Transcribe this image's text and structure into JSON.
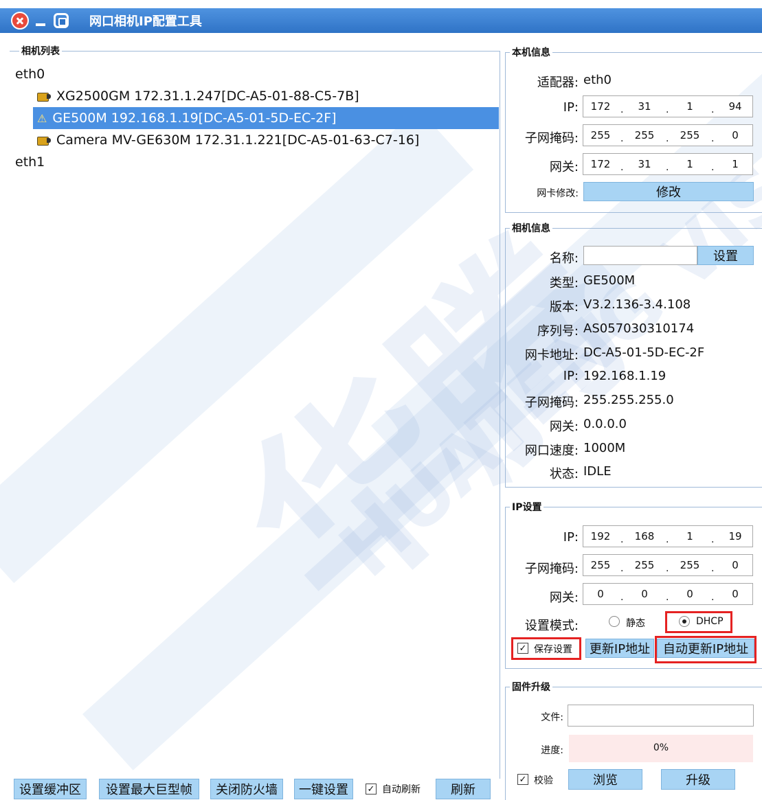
{
  "window": {
    "title": "网口相机IP配置工具"
  },
  "watermark": {
    "brand_cn": "华腾",
    "brand_en": "HUATENG VISION"
  },
  "camera_list": {
    "title": "相机列表",
    "adapters": [
      {
        "name": "eth0",
        "cameras": [
          {
            "label": "XG2500GM 172.31.1.247[DC-A5-01-88-C5-7B]",
            "icon": "camera-icon",
            "selected": false
          },
          {
            "label": "GE500M 192.168.1.19[DC-A5-01-5D-EC-2F]",
            "icon": "warning-icon",
            "selected": true
          },
          {
            "label": "Camera MV-GE630M 172.31.1.221[DC-A5-01-63-C7-16]",
            "icon": "camera-icon",
            "selected": false
          }
        ]
      },
      {
        "name": "eth1",
        "cameras": []
      }
    ]
  },
  "bottom": {
    "set_buffer": "设置缓冲区",
    "set_jumbo": "设置最大巨型帧",
    "close_firewall": "关闭防火墙",
    "one_key": "一键设置",
    "auto_refresh": "自动刷新",
    "auto_refresh_checked": true,
    "refresh": "刷新"
  },
  "local_info": {
    "title": "本机信息",
    "adapter_label": "适配器:",
    "adapter_value": "eth0",
    "ip_label": "IP:",
    "ip": [
      "172",
      "31",
      "1",
      "94"
    ],
    "mask_label": "子网掩码:",
    "mask": [
      "255",
      "255",
      "255",
      "0"
    ],
    "gateway_label": "网关:",
    "gateway": [
      "172",
      "31",
      "1",
      "1"
    ],
    "nic_modify_label": "网卡修改:",
    "modify_button": "修改"
  },
  "camera_info": {
    "title": "相机信息",
    "name_label": "名称:",
    "name_value": "",
    "set_button": "设置",
    "fields": [
      {
        "label": "类型:",
        "value": "GE500M"
      },
      {
        "label": "版本:",
        "value": "V3.2.136-3.4.108"
      },
      {
        "label": "序列号:",
        "value": "AS057030310174"
      },
      {
        "label": "网卡地址:",
        "value": "DC-A5-01-5D-EC-2F"
      },
      {
        "label": "IP:",
        "value": "192.168.1.19"
      },
      {
        "label": "子网掩码:",
        "value": "255.255.255.0"
      },
      {
        "label": "网关:",
        "value": "0.0.0.0"
      },
      {
        "label": "网口速度:",
        "value": "1000M"
      },
      {
        "label": "状态:",
        "value": "IDLE"
      }
    ]
  },
  "ip_settings": {
    "title": "IP设置",
    "ip_label": "IP:",
    "ip": [
      "192",
      "168",
      "1",
      "19"
    ],
    "mask_label": "子网掩码:",
    "mask": [
      "255",
      "255",
      "255",
      "0"
    ],
    "gateway_label": "网关:",
    "gateway": [
      "0",
      "0",
      "0",
      "0"
    ],
    "mode_label": "设置模式:",
    "static_label": "静态",
    "dhcp_label": "DHCP",
    "mode_selected": "DHCP",
    "save_label": "保存设置",
    "save_checked": true,
    "update_button": "更新IP地址",
    "auto_update_button": "自动更新IP地址"
  },
  "firmware": {
    "title": "固件升级",
    "file_label": "文件:",
    "file_value": "",
    "progress_label": "进度:",
    "progress_text": "0%",
    "progress_fraction": 0,
    "verify_label": "校验",
    "verify_checked": true,
    "browse_button": "浏览",
    "upgrade_button": "升级"
  }
}
